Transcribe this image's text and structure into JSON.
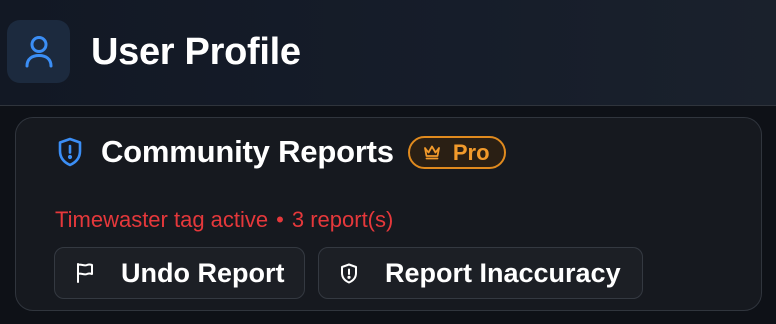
{
  "header": {
    "title": "User Profile",
    "icon": "user-icon",
    "icon_color": "#3b8ef5"
  },
  "card": {
    "icon": "shield-alert-icon",
    "icon_color": "#3b8ef5",
    "title": "Community Reports",
    "badge": {
      "icon": "crown-icon",
      "label": "Pro",
      "color": "#f29a2b"
    },
    "status": {
      "tag_text": "Timewaster tag active",
      "separator": "•",
      "report_text": "3 report(s)",
      "color": "#e5383b"
    },
    "buttons": [
      {
        "icon": "flag-icon",
        "label": "Undo Report"
      },
      {
        "icon": "shield-alert-icon",
        "label": "Report Inaccuracy"
      }
    ]
  }
}
